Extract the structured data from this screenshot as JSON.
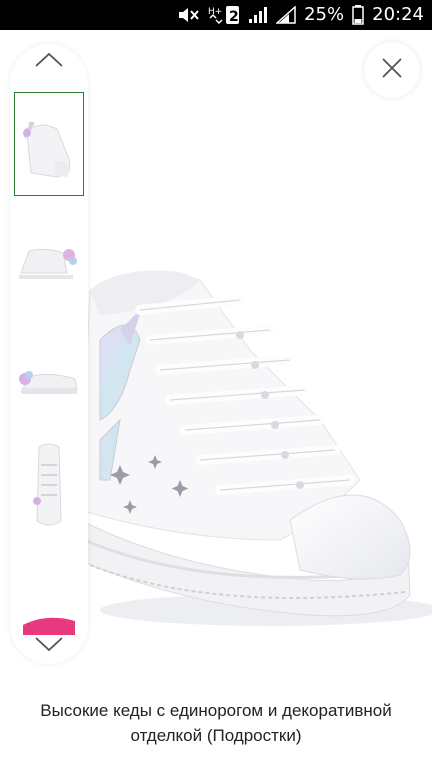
{
  "status_bar": {
    "battery_percent": "25%",
    "time": "20:24",
    "network_label": "H+",
    "sim_slot": "2",
    "icons": [
      "mute-icon",
      "network-icon",
      "signal-icon",
      "signal-icon-2",
      "battery-icon"
    ]
  },
  "viewer": {
    "nav_up_icon": "chevron-up-icon",
    "nav_down_icon": "chevron-down-icon",
    "close_icon": "close-icon",
    "active_thumb_color": "#2e7d32",
    "thumbnails": [
      {
        "view": "side-angle",
        "active": true
      },
      {
        "view": "side",
        "active": false
      },
      {
        "view": "side-low",
        "active": false
      },
      {
        "view": "top",
        "active": false
      },
      {
        "view": "sole",
        "active": false
      }
    ]
  },
  "product": {
    "title": "Высокие кеды с единорогом и декоративной отделкой (Подростки)"
  }
}
